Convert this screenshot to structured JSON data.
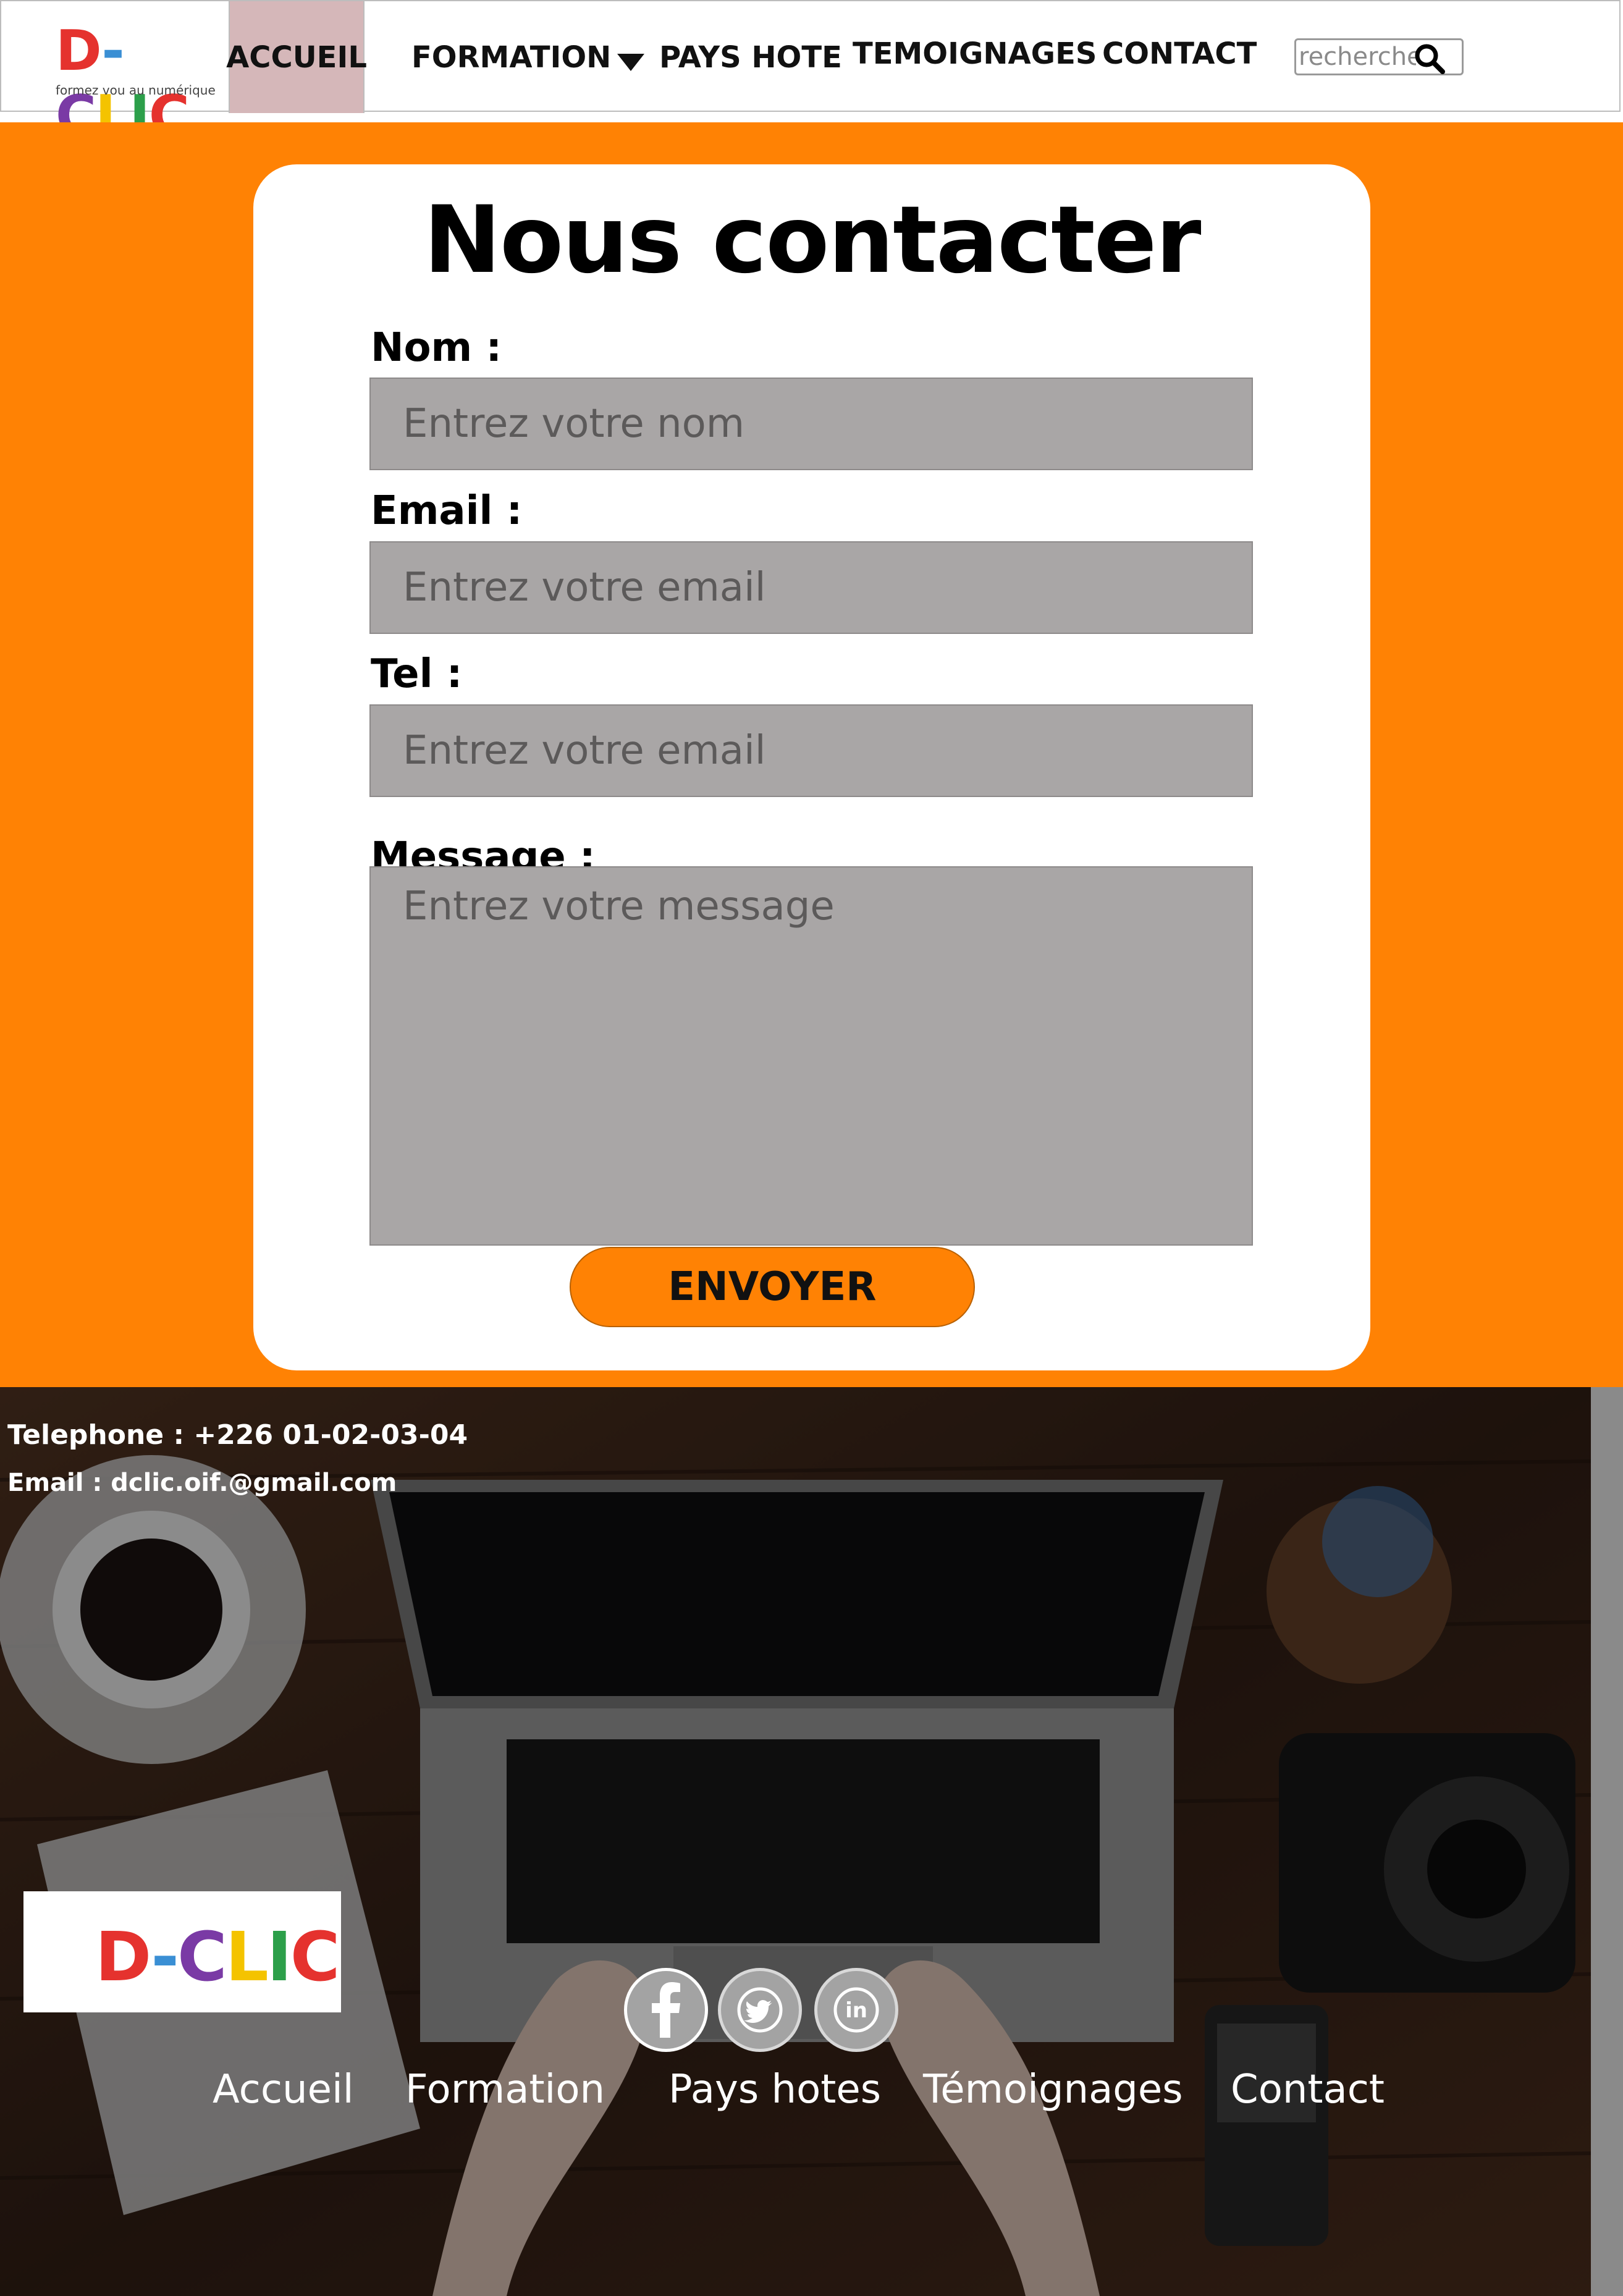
{
  "brand": {
    "logo_text": "D-CLIC",
    "tagline": "formez vou au numérique",
    "colors": {
      "d": "#e5322e",
      "dash": "#3a8fd4",
      "c": "#7a3aa5",
      "l": "#f4c300",
      "i": "#2c9f4a",
      "c2": "#e5322e"
    }
  },
  "nav": {
    "items": [
      {
        "label": "ACCUEIL",
        "active": true
      },
      {
        "label": "FORMATION",
        "dropdown": true
      },
      {
        "label": "PAYS HOTE"
      },
      {
        "label": "TEMOIGNAGES"
      },
      {
        "label": "CONTACT"
      }
    ],
    "search_placeholder": "recherche",
    "search_icon": "search-icon"
  },
  "contact_form": {
    "title": "Nous contacter",
    "fields": [
      {
        "label": "Nom :",
        "placeholder": "Entrez votre nom"
      },
      {
        "label": "Email :",
        "placeholder": "Entrez votre email"
      },
      {
        "label": "Tel :",
        "placeholder": "Entrez votre email"
      },
      {
        "label": "Message :",
        "placeholder": "Entrez votre message"
      }
    ],
    "submit_label": "ENVOYER"
  },
  "footer": {
    "telephone": "Telephone : +226 01-02-03-04",
    "email": "Email : dclic.oif.@gmail.com",
    "social": [
      "facebook-icon",
      "twitter-icon",
      "linkedin-icon"
    ],
    "links": [
      "Accueil",
      "Formation",
      "Pays hotes",
      "Témoignages",
      "Contact"
    ]
  },
  "colors": {
    "accent": "#ff8204",
    "nav_active": "#d5b7b9",
    "field_bg": "#a9a6a6"
  }
}
